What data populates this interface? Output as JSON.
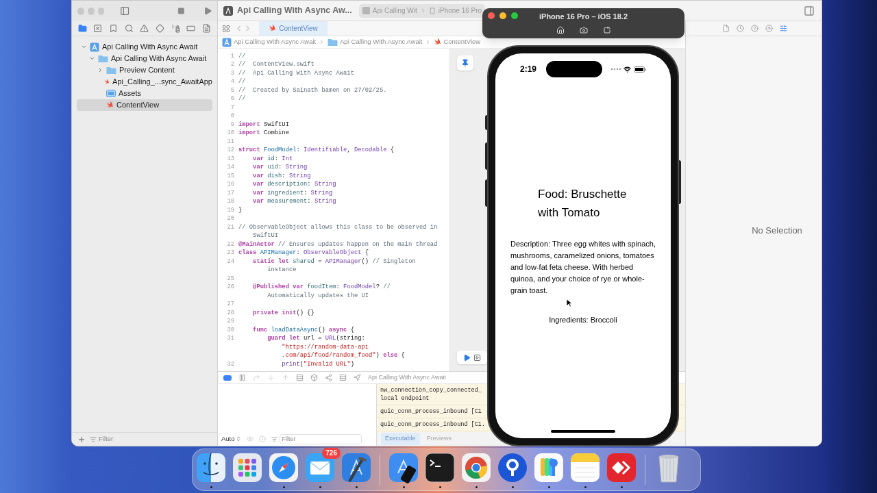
{
  "xcode": {
    "toolbar": {
      "project_title": "Api Calling With Async Aw...",
      "scheme": "Api Calling Wit",
      "destination": "iPhone 16 Pro"
    },
    "editor_tab": {
      "label": "ContentView",
      "selected": true
    },
    "breadcrumb": [
      "Api Calling With Async Await",
      "Api Calling With Async Await",
      "ContentView"
    ],
    "navigator": {
      "filter_placeholder": "Filter",
      "items": [
        {
          "label": "Api Calling With Async Await",
          "kind": "project",
          "expanded": true,
          "selected": false,
          "children": [
            {
              "label": "Api Calling With Async Await",
              "kind": "folder",
              "expanded": true,
              "selected": false,
              "children": [
                {
                  "label": "Preview Content",
                  "kind": "folder",
                  "expanded": false,
                  "selected": false
                },
                {
                  "label": "Api_Calling_...sync_AwaitApp",
                  "kind": "swift",
                  "selected": false
                },
                {
                  "label": "Assets",
                  "kind": "assets",
                  "selected": false
                },
                {
                  "label": "ContentView",
                  "kind": "swift",
                  "selected": true
                }
              ]
            }
          ]
        }
      ]
    },
    "code": [
      {
        "num": "1",
        "parts": [
          {
            "kind": "comment",
            "text": "//"
          }
        ]
      },
      {
        "num": "2",
        "parts": [
          {
            "kind": "comment",
            "text": "//  ContentView.swift"
          }
        ]
      },
      {
        "num": "3",
        "parts": [
          {
            "kind": "comment",
            "text": "//  Api Calling With Async Await"
          }
        ]
      },
      {
        "num": "4",
        "parts": [
          {
            "kind": "comment",
            "text": "//"
          }
        ]
      },
      {
        "num": "5",
        "parts": [
          {
            "kind": "comment",
            "text": "//  Created by Sainath bamen on 27/02/25."
          }
        ]
      },
      {
        "num": "6",
        "parts": [
          {
            "kind": "comment",
            "text": "//"
          }
        ]
      },
      {
        "num": "7"
      },
      {
        "num": "8"
      },
      {
        "num": "9",
        "parts": [
          {
            "kind": "keyword",
            "text": "import "
          },
          {
            "kind": "plain",
            "text": "SwiftUI"
          }
        ]
      },
      {
        "num": "10",
        "parts": [
          {
            "kind": "keyword",
            "text": "import "
          },
          {
            "kind": "plain",
            "text": "Combine"
          }
        ]
      },
      {
        "num": "11"
      },
      {
        "num": "12",
        "parts": [
          {
            "kind": "keyword",
            "text": "struct "
          },
          {
            "kind": "decl",
            "text": "FoodModel"
          },
          {
            "kind": "plain",
            "text": ": "
          },
          {
            "kind": "type",
            "text": "Identifiable"
          },
          {
            "kind": "plain",
            "text": ", "
          },
          {
            "kind": "type",
            "text": "Decodable"
          },
          {
            "kind": "plain",
            "text": " {"
          }
        ]
      },
      {
        "num": "13",
        "parts": [
          {
            "kind": "keyword",
            "text": "    var "
          },
          {
            "kind": "prop",
            "text": "id"
          },
          {
            "kind": "plain",
            "text": ": "
          },
          {
            "kind": "type",
            "text": "Int"
          }
        ]
      },
      {
        "num": "14",
        "parts": [
          {
            "kind": "keyword",
            "text": "    var "
          },
          {
            "kind": "prop",
            "text": "uid"
          },
          {
            "kind": "plain",
            "text": ": "
          },
          {
            "kind": "type",
            "text": "String"
          }
        ]
      },
      {
        "num": "15",
        "parts": [
          {
            "kind": "keyword",
            "text": "    var "
          },
          {
            "kind": "prop",
            "text": "dish"
          },
          {
            "kind": "plain",
            "text": ": "
          },
          {
            "kind": "type",
            "text": "String"
          }
        ]
      },
      {
        "num": "16",
        "parts": [
          {
            "kind": "keyword",
            "text": "    var "
          },
          {
            "kind": "prop",
            "text": "description"
          },
          {
            "kind": "plain",
            "text": ": "
          },
          {
            "kind": "type",
            "text": "String"
          }
        ]
      },
      {
        "num": "17",
        "parts": [
          {
            "kind": "keyword",
            "text": "    var "
          },
          {
            "kind": "prop",
            "text": "ingredient"
          },
          {
            "kind": "plain",
            "text": ": "
          },
          {
            "kind": "type",
            "text": "String"
          }
        ]
      },
      {
        "num": "18",
        "parts": [
          {
            "kind": "keyword",
            "text": "    var "
          },
          {
            "kind": "prop",
            "text": "measurement"
          },
          {
            "kind": "plain",
            "text": ": "
          },
          {
            "kind": "type",
            "text": "String"
          }
        ]
      },
      {
        "num": "19",
        "parts": [
          {
            "kind": "plain",
            "text": "}"
          }
        ]
      },
      {
        "num": "20"
      },
      {
        "num": "21",
        "parts": [
          {
            "kind": "comment",
            "text": "// ObservableObject allows this class to be observed in"
          }
        ]
      },
      {
        "parts": [
          {
            "kind": "comment",
            "text": "    SwiftUI"
          }
        ]
      },
      {
        "num": "22",
        "parts": [
          {
            "kind": "keyword",
            "text": "@MainActor"
          },
          {
            "kind": "comment",
            "text": " // Ensures updates happen on the main thread"
          }
        ]
      },
      {
        "num": "23",
        "parts": [
          {
            "kind": "keyword",
            "text": "class "
          },
          {
            "kind": "decl",
            "text": "APIManager"
          },
          {
            "kind": "plain",
            "text": ": "
          },
          {
            "kind": "type",
            "text": "ObservableObject"
          },
          {
            "kind": "plain",
            "text": " {"
          }
        ]
      },
      {
        "num": "24",
        "parts": [
          {
            "kind": "keyword",
            "text": "    static let "
          },
          {
            "kind": "prop",
            "text": "shared"
          },
          {
            "kind": "plain",
            "text": " = "
          },
          {
            "kind": "type",
            "text": "APIManager"
          },
          {
            "kind": "plain",
            "text": "() "
          },
          {
            "kind": "comment",
            "text": "// Singleton"
          }
        ]
      },
      {
        "parts": [
          {
            "kind": "comment",
            "text": "        instance"
          }
        ]
      },
      {
        "num": "25"
      },
      {
        "num": "26",
        "parts": [
          {
            "kind": "keyword",
            "text": "    @Published var "
          },
          {
            "kind": "prop",
            "text": "foodItem"
          },
          {
            "kind": "plain",
            "text": ": "
          },
          {
            "kind": "type",
            "text": "FoodModel"
          },
          {
            "kind": "plain",
            "text": "? "
          },
          {
            "kind": "comment",
            "text": "//"
          }
        ]
      },
      {
        "parts": [
          {
            "kind": "comment",
            "text": "        Automatically updates the UI"
          }
        ]
      },
      {
        "num": "27"
      },
      {
        "num": "28",
        "parts": [
          {
            "kind": "keyword",
            "text": "    private init"
          },
          {
            "kind": "plain",
            "text": "() {}"
          }
        ]
      },
      {
        "num": "29"
      },
      {
        "num": "30",
        "parts": [
          {
            "kind": "keyword",
            "text": "    func "
          },
          {
            "kind": "decl",
            "text": "loadDataAsync"
          },
          {
            "kind": "plain",
            "text": "() "
          },
          {
            "kind": "keyword",
            "text": "async"
          },
          {
            "kind": "plain",
            "text": " {"
          }
        ]
      },
      {
        "num": "31",
        "parts": [
          {
            "kind": "keyword",
            "text": "        guard let "
          },
          {
            "kind": "plain",
            "text": "url = "
          },
          {
            "kind": "type",
            "text": "URL"
          },
          {
            "kind": "plain",
            "text": "(string:"
          }
        ]
      },
      {
        "parts": [
          {
            "kind": "string",
            "text": "            \"https://random-data-api"
          }
        ]
      },
      {
        "parts": [
          {
            "kind": "string",
            "text": "            .com/api/food/random_food\""
          },
          {
            "kind": "plain",
            "text": ") "
          },
          {
            "kind": "keyword",
            "text": "else"
          },
          {
            "kind": "plain",
            "text": " {"
          }
        ]
      },
      {
        "num": "32",
        "parts": [
          {
            "kind": "type",
            "text": "            print"
          },
          {
            "kind": "plain",
            "text": "("
          },
          {
            "kind": "string",
            "text": "\"Invalid URL\""
          },
          {
            "kind": "plain",
            "text": ")"
          }
        ]
      }
    ],
    "debug": {
      "target": "Api Calling With Async Await",
      "scope": "Auto",
      "filter_placeholder": "Filter",
      "console": [
        {
          "lines": [
            "nw_connection_copy_connected_",
            "local endpoint"
          ]
        },
        {
          "lines": [
            "quic_conn_process_inbound [C1"
          ]
        },
        {
          "lines": [
            "quic_conn_process_inbound [C1."
          ]
        }
      ],
      "console_tabs": [
        {
          "label": "Executable",
          "selected": true
        },
        {
          "label": "Previews",
          "selected": false
        }
      ]
    },
    "inspector": {
      "message": "No Selection"
    }
  },
  "simulator": {
    "title": "iPhone 16 Pro – iOS 18.2",
    "time": "2:19",
    "heading": "Food: Bruschette with Tomato",
    "description": "Description: Three egg whites with spinach, mushrooms, caramelized onions, tomatoes and low-fat feta cheese. With herbed quinoa, and your choice of rye or whole-grain toast.",
    "ingredients": "Ingredients: Broccoli"
  },
  "dock": [
    [
      {
        "kind": "finder",
        "running": true
      },
      {
        "kind": "launchpad",
        "running": false
      },
      {
        "kind": "safari",
        "running": true
      },
      {
        "kind": "mail",
        "running": true,
        "badge": "726"
      },
      {
        "kind": "xcode",
        "running": true
      }
    ],
    [
      {
        "kind": "simulator",
        "running": true
      },
      {
        "kind": "terminal",
        "running": true
      },
      {
        "kind": "chrome",
        "running": true
      },
      {
        "kind": "keyhole",
        "running": true
      },
      {
        "kind": "passwords",
        "running": true
      },
      {
        "kind": "notes",
        "running": true
      },
      {
        "kind": "remote",
        "running": true
      }
    ],
    [
      {
        "kind": "trash",
        "running": false
      }
    ]
  ]
}
